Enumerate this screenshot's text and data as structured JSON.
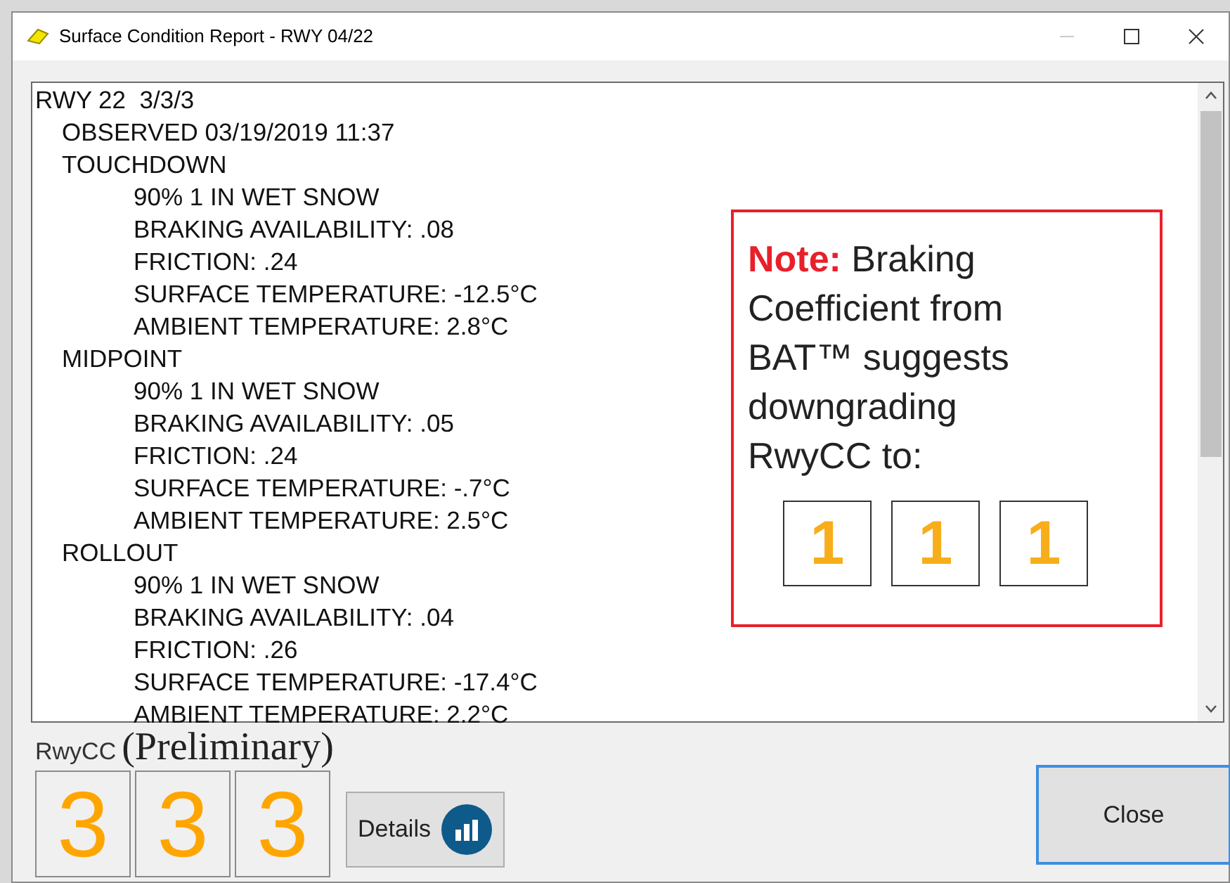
{
  "window": {
    "title": "Surface Condition Report - RWY 04/22"
  },
  "report": [
    {
      "text": "RWY 22  3/3/3",
      "children": [
        {
          "text": "OBSERVED 03/19/2019 11:37"
        },
        {
          "text": "TOUCHDOWN",
          "children": [
            {
              "text": "90% 1 IN WET SNOW"
            },
            {
              "text": "BRAKING AVAILABILITY: .08"
            },
            {
              "text": "FRICTION: .24"
            },
            {
              "text": "SURFACE TEMPERATURE: -12.5°C"
            },
            {
              "text": "AMBIENT TEMPERATURE: 2.8°C"
            }
          ]
        },
        {
          "text": "MIDPOINT",
          "children": [
            {
              "text": "90% 1 IN WET SNOW"
            },
            {
              "text": "BRAKING AVAILABILITY: .05"
            },
            {
              "text": "FRICTION: .24"
            },
            {
              "text": "SURFACE TEMPERATURE: -.7°C"
            },
            {
              "text": "AMBIENT TEMPERATURE: 2.5°C"
            }
          ]
        },
        {
          "text": "ROLLOUT",
          "children": [
            {
              "text": "90% 1 IN WET SNOW"
            },
            {
              "text": "BRAKING AVAILABILITY: .04"
            },
            {
              "text": "FRICTION: .26"
            },
            {
              "text": "SURFACE TEMPERATURE: -17.4°C"
            },
            {
              "text": "AMBIENT TEMPERATURE: 2.2°C"
            }
          ]
        }
      ]
    }
  ],
  "note": {
    "text": "**Note:** Braking Coefficient from BAT™ suggests downgrading RwyCC to:",
    "codes": [
      "1",
      "1",
      "1"
    ]
  },
  "rwycc": {
    "label": "RwyCC",
    "qualifier": "(Preliminary)",
    "codes": [
      "3",
      "3",
      "3"
    ]
  },
  "buttons": {
    "details": "Details",
    "close": "Close"
  }
}
